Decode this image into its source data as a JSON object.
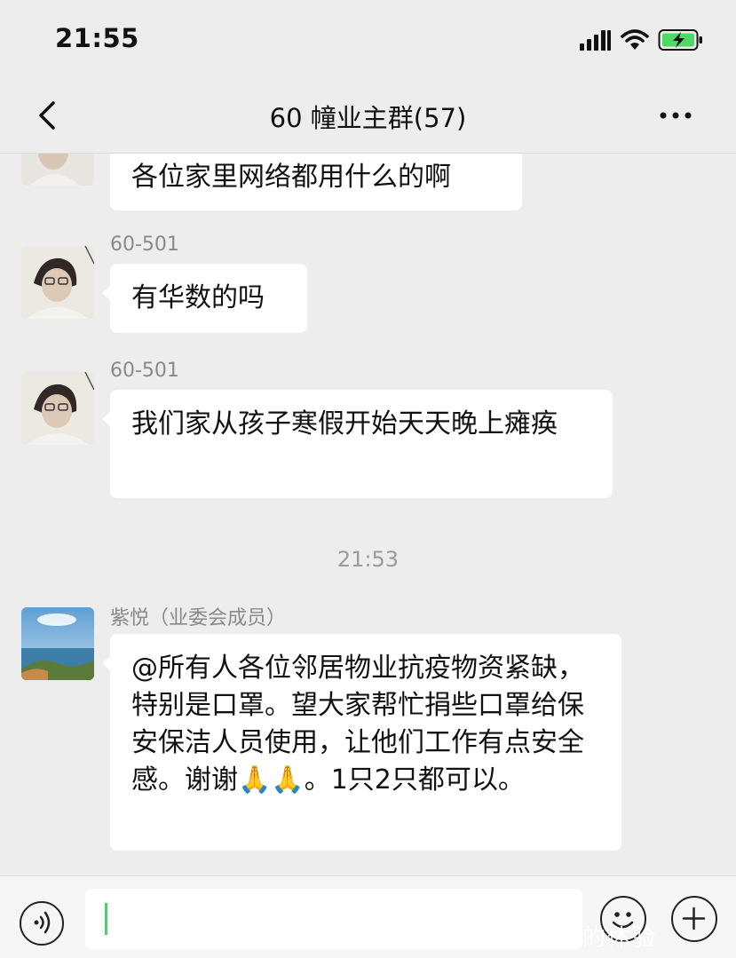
{
  "status_bar": {
    "time": "21:55"
  },
  "header": {
    "back_icon": "chevron-left-icon",
    "title": "60 幢业主群(57)",
    "more_icon": "ellipsis-icon"
  },
  "messages": [
    {
      "sender": "",
      "text": "各位家里网络都用什么的啊"
    },
    {
      "sender": "60-501",
      "text": "有华数的吗"
    },
    {
      "sender": "60-501",
      "text": "我们家从孩子寒假开始天天晚上瘫痪"
    },
    {
      "time_divider": "21:53"
    },
    {
      "sender": "紫悦（业委会成员）",
      "text": "@所有人各位邻居物业抗疫物资紧缺，特别是口罩。望大家帮忙捐些口罩给保安保洁人员使用，让他们工作有点安全感。谢谢🙏🙏。1只2只都可以。"
    }
  ],
  "input_bar": {
    "voice_icon": "voice-icon",
    "emoji_icon": "emoji-icon",
    "plus_icon": "plus-icon"
  },
  "watermark": "女性的体验",
  "colors": {
    "background": "#ededed",
    "bubble": "#ffffff",
    "battery": "#4cd964",
    "caret": "#5fc47a"
  }
}
